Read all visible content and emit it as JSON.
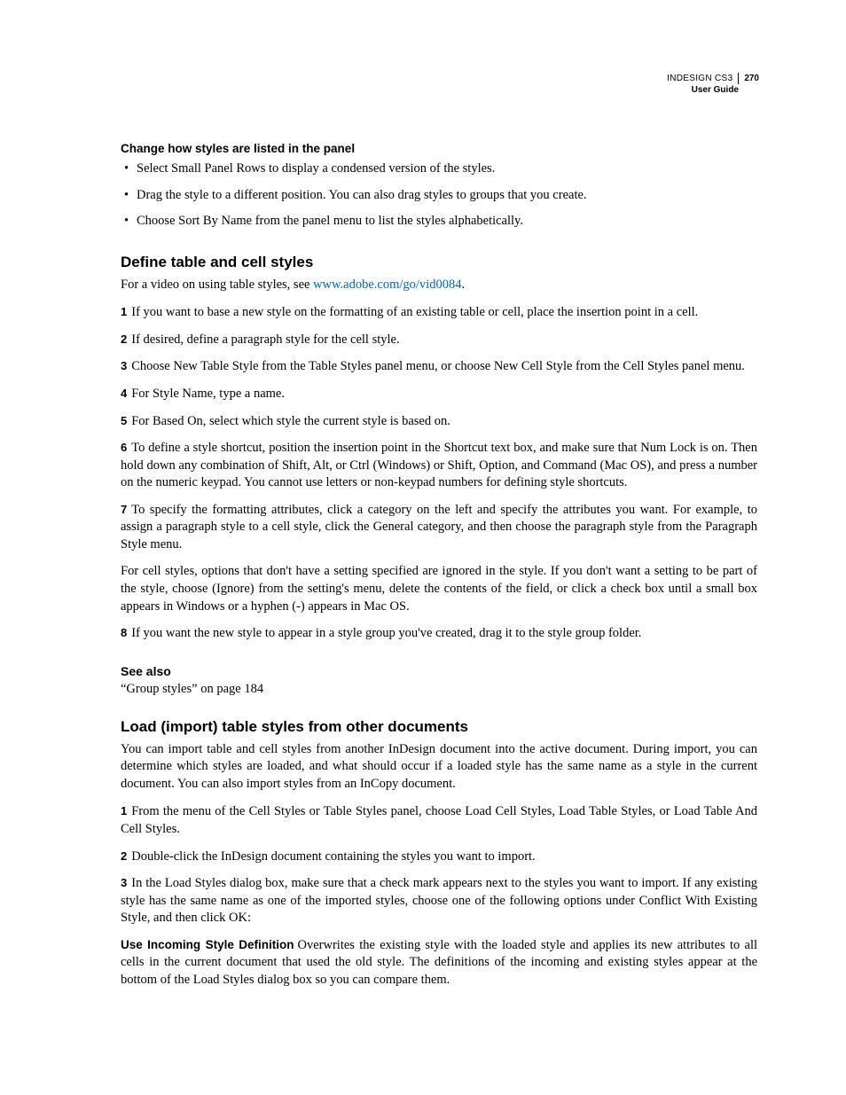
{
  "header": {
    "product": "INDESIGN CS3",
    "page_num": "270",
    "guide": "User Guide"
  },
  "section1": {
    "title": "Change how styles are listed in the panel",
    "bullets": [
      "Select Small Panel Rows to display a condensed version of the styles.",
      "Drag the style to a different position. You can also drag styles to groups that you create.",
      "Choose Sort By Name from the panel menu to list the styles alphabetically."
    ]
  },
  "section2": {
    "title": "Define table and cell styles",
    "intro_prefix": "For a video on using table styles, see ",
    "intro_link": "www.adobe.com/go/vid0084",
    "intro_suffix": ".",
    "steps": {
      "s1": "If you want to base a new style on the formatting of an existing table or cell, place the insertion point in a cell.",
      "s2": "If desired, define a paragraph style for the cell style.",
      "s3": "Choose New Table Style from the Table Styles panel menu, or choose New Cell Style from the Cell Styles panel menu.",
      "s4": "For Style Name, type a name.",
      "s5": "For Based On, select which style the current style is based on.",
      "s6": "To define a style shortcut, position the insertion point in the Shortcut text box, and make sure that Num Lock is on. Then hold down any combination of Shift, Alt, or Ctrl (Windows) or Shift, Option, and Command (Mac OS), and press a number on the numeric keypad. You cannot use letters or non-keypad numbers for defining style shortcuts.",
      "s7": "To specify the formatting attributes, click a category on the left and specify the attributes you want. For example, to assign a paragraph style to a cell style, click the General category, and then choose the paragraph style from the Paragraph Style menu.",
      "p7b": "For cell styles, options that don't have a setting specified are ignored in the style. If you don't want a setting to be part of the style, choose (Ignore) from the setting's menu, delete the contents of the field, or click a check box until a small box appears in Windows or a hyphen (-) appears in Mac OS.",
      "s8": "If you want the new style to appear in a style group you've created, drag it to the style group folder."
    },
    "see_also_title": "See also",
    "see_also_item": "“Group styles” on page 184"
  },
  "section3": {
    "title": "Load (import) table styles from other documents",
    "intro": "You can import table and cell styles from another InDesign document into the active document. During import, you can determine which styles are loaded, and what should occur if a loaded style has the same name as a style in the current document. You can also import styles from an InCopy document.",
    "steps": {
      "s1": "From the menu of the Cell Styles or Table Styles panel, choose Load Cell Styles, Load Table Styles, or Load Table And Cell Styles.",
      "s2": "Double-click the InDesign document containing the styles you want to import.",
      "s3": "In the Load Styles dialog box, make sure that a check mark appears next to the styles you want to import. If any existing style has the same name as one of the imported styles, choose one of the following options under Conflict With Existing Style, and then click OK:"
    },
    "def_label": "Use Incoming Style Definition",
    "def_text": "Overwrites the existing style with the loaded style and applies its new attributes to all cells in the current document that used the old style. The definitions of the incoming and existing styles appear at the bottom of the Load Styles dialog box so you can compare them."
  },
  "nums": {
    "n1": "1",
    "n2": "2",
    "n3": "3",
    "n4": "4",
    "n5": "5",
    "n6": "6",
    "n7": "7",
    "n8": "8"
  }
}
